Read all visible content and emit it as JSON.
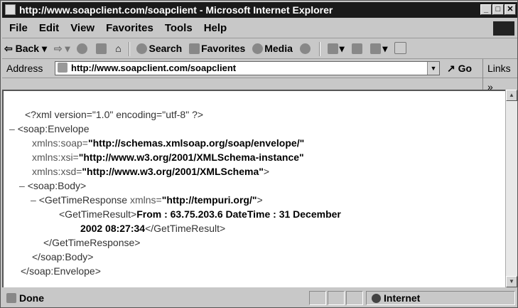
{
  "window": {
    "title": "http://www.soapclient.com/soapclient - Microsoft Internet Explorer"
  },
  "menu": [
    "File",
    "Edit",
    "View",
    "Favorites",
    "Tools",
    "Help"
  ],
  "toolbar": {
    "back": "Back",
    "search": "Search",
    "favorites": "Favorites",
    "media": "Media"
  },
  "address": {
    "label": "Address",
    "url": "http://www.soapclient.com/soapclient",
    "go": "Go",
    "links": "Links"
  },
  "xml": {
    "decl": "<?xml version=\"1.0\" encoding=\"utf-8\" ?>",
    "env_open": "<soap:Envelope",
    "ns_soap_attr": "xmlns:soap=",
    "ns_soap_val": "\"http://schemas.xmlsoap.org/soap/envelope/\"",
    "ns_xsi_attr": "xmlns:xsi=",
    "ns_xsi_val": "\"http://www.w3.org/2001/XMLSchema-instance\"",
    "ns_xsd_attr": "xmlns:xsd=",
    "ns_xsd_val": "\"http://www.w3.org/2001/XMLSchema\"",
    "ns_close": ">",
    "body_open": "<soap:Body>",
    "resp_open": "<GetTimeResponse",
    "resp_ns_attr": "xmlns=",
    "resp_ns_val": "\"http://tempuri.org/\"",
    "resp_close": ">",
    "result_open": "<GetTimeResult>",
    "result_text1": "From : 63.75.203.6 DateTime : 31 December",
    "result_text2": "2002 08:27:34",
    "result_close": "</GetTimeResult>",
    "resp_end": "</GetTimeResponse>",
    "body_end": "</soap:Body>",
    "env_end": "</soap:Envelope>",
    "dash": "–"
  },
  "status": {
    "text": "Done",
    "zone": "Internet"
  }
}
